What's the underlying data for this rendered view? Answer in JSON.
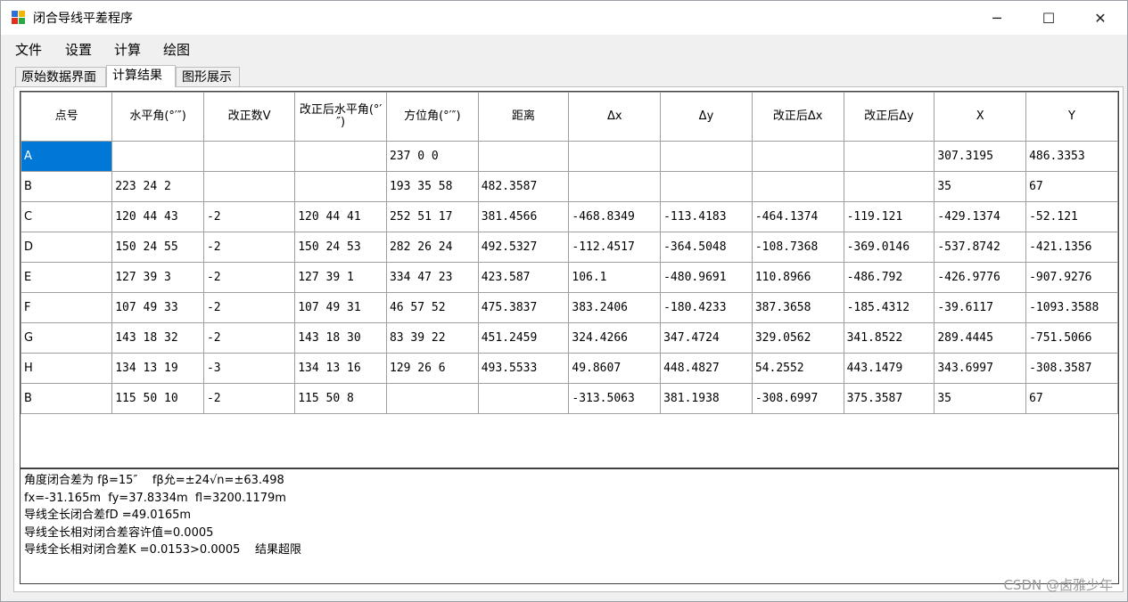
{
  "window": {
    "title": "闭合导线平差程序",
    "minimize_glyph": "─",
    "maximize_glyph": "☐",
    "close_glyph": "✕"
  },
  "menu": [
    "文件",
    "设置",
    "计算",
    "绘图"
  ],
  "tabs": [
    {
      "label": "原始数据界面",
      "active": false
    },
    {
      "label": "计算结果",
      "active": true
    },
    {
      "label": "图形展示",
      "active": false
    }
  ],
  "table": {
    "headers": [
      "点号",
      "水平角(°′″)",
      "改正数V",
      "改正后水平角(°′″)",
      "方位角(°′″)",
      "距离",
      "Δx",
      "Δy",
      "改正后Δx",
      "改正后Δy",
      "X",
      "Y"
    ],
    "rows": [
      [
        "A",
        "",
        "",
        "",
        "237 0 0",
        "",
        "",
        "",
        "",
        "",
        "307.3195",
        "486.3353"
      ],
      [
        "B",
        "223 24 2",
        "",
        "",
        "193 35 58",
        "482.3587",
        "",
        "",
        "",
        "",
        "35",
        "67"
      ],
      [
        "C",
        "120 44 43",
        "-2",
        "120 44 41",
        "252 51 17",
        "381.4566",
        "-468.8349",
        "-113.4183",
        "-464.1374",
        "-119.121",
        "-429.1374",
        "-52.121"
      ],
      [
        "D",
        "150 24 55",
        "-2",
        "150 24 53",
        "282 26 24",
        "492.5327",
        "-112.4517",
        "-364.5048",
        "-108.7368",
        "-369.0146",
        "-537.8742",
        "-421.1356"
      ],
      [
        "E",
        "127 39 3",
        "-2",
        "127 39 1",
        "334 47 23",
        "423.587",
        "106.1",
        "-480.9691",
        "110.8966",
        "-486.792",
        "-426.9776",
        "-907.9276"
      ],
      [
        "F",
        "107 49 33",
        "-2",
        "107 49 31",
        "46 57 52",
        "475.3837",
        "383.2406",
        "-180.4233",
        "387.3658",
        "-185.4312",
        "-39.6117",
        "-1093.3588"
      ],
      [
        "G",
        "143 18 32",
        "-2",
        "143 18 30",
        "83 39 22",
        "451.2459",
        "324.4266",
        "347.4724",
        "329.0562",
        "341.8522",
        "289.4445",
        "-751.5066"
      ],
      [
        "H",
        "134 13 19",
        "-3",
        "134 13 16",
        "129 26 6",
        "493.5533",
        "49.8607",
        "448.4827",
        "54.2552",
        "443.1479",
        "343.6997",
        "-308.3587"
      ],
      [
        "B",
        "115 50 10",
        "-2",
        "115 50 8",
        "",
        "",
        "-313.5063",
        "381.1938",
        "-308.6997",
        "375.3587",
        "35",
        "67"
      ]
    ],
    "selected_cell": {
      "row": 0,
      "col": 0
    },
    "selection_color": "#0078d7"
  },
  "results": [
    "角度闭合差为 fβ=15″    fβ允=±24√n=±63.498",
    "fx=-31.165m  fy=37.8334m  fl=3200.1179m",
    "导线全长闭合差fD =49.0165m",
    "导线全长相对闭合差容许值=0.0005",
    "导线全长相对闭合差K =0.0153>0.0005    结果超限"
  ],
  "watermark": "CSDN @卤雅少年"
}
